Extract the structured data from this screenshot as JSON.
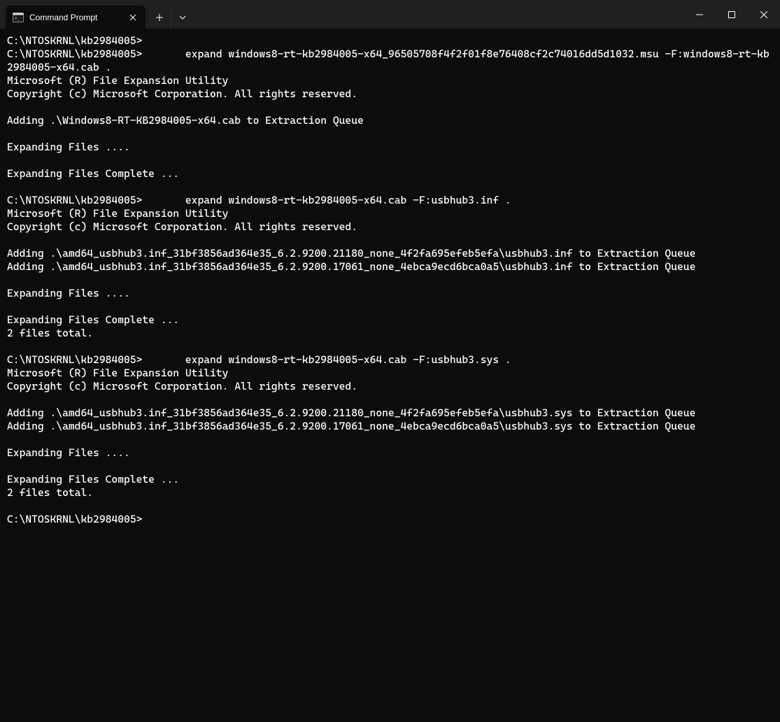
{
  "tab": {
    "title": "Command Prompt"
  },
  "terminal": {
    "lines": [
      "C:\\NTOSKRNL\\kb2984005>",
      "C:\\NTOSKRNL\\kb2984005>       expand windows8-rt-kb2984005-x64_96505708f4f2f01f8e76408cf2c74016dd5d1032.msu -F:windows8-rt-kb2984005-x64.cab .",
      "Microsoft (R) File Expansion Utility",
      "Copyright (c) Microsoft Corporation. All rights reserved.",
      "",
      "Adding .\\Windows8-RT-KB2984005-x64.cab to Extraction Queue",
      "",
      "Expanding Files ....",
      "",
      "Expanding Files Complete ...",
      "",
      "C:\\NTOSKRNL\\kb2984005>       expand windows8-rt-kb2984005-x64.cab -F:usbhub3.inf .",
      "Microsoft (R) File Expansion Utility",
      "Copyright (c) Microsoft Corporation. All rights reserved.",
      "",
      "Adding .\\amd64_usbhub3.inf_31bf3856ad364e35_6.2.9200.21180_none_4f2fa695efeb5efa\\usbhub3.inf to Extraction Queue",
      "Adding .\\amd64_usbhub3.inf_31bf3856ad364e35_6.2.9200.17061_none_4ebca9ecd6bca0a5\\usbhub3.inf to Extraction Queue",
      "",
      "Expanding Files ....",
      "",
      "Expanding Files Complete ...",
      "2 files total.",
      "",
      "C:\\NTOSKRNL\\kb2984005>       expand windows8-rt-kb2984005-x64.cab -F:usbhub3.sys .",
      "Microsoft (R) File Expansion Utility",
      "Copyright (c) Microsoft Corporation. All rights reserved.",
      "",
      "Adding .\\amd64_usbhub3.inf_31bf3856ad364e35_6.2.9200.21180_none_4f2fa695efeb5efa\\usbhub3.sys to Extraction Queue",
      "Adding .\\amd64_usbhub3.inf_31bf3856ad364e35_6.2.9200.17061_none_4ebca9ecd6bca0a5\\usbhub3.sys to Extraction Queue",
      "",
      "Expanding Files ....",
      "",
      "Expanding Files Complete ...",
      "2 files total.",
      "",
      "C:\\NTOSKRNL\\kb2984005>"
    ]
  }
}
